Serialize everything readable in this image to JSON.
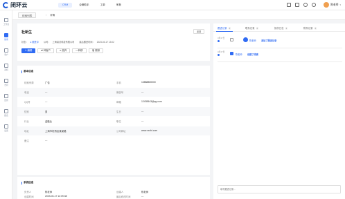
{
  "app": {
    "name": "闭环云"
  },
  "topnav": [
    "CRM",
    "企微助手",
    "工单",
    "审批"
  ],
  "user": {
    "name": "陈老师"
  },
  "sidebar": [
    {
      "label": "工作台"
    },
    {
      "label": "线索"
    },
    {
      "label": "客户"
    },
    {
      "label": "商机"
    },
    {
      "label": "合同"
    },
    {
      "label": "回款"
    },
    {
      "label": "报表"
    },
    {
      "label": "设置"
    }
  ],
  "tabs": {
    "list": "线索列表",
    "sep": "/",
    "detail": "详情"
  },
  "lead": {
    "name": "杜新生",
    "collapse": "返回",
    "meta": {
      "status_label": "状态：",
      "status": "● 跟进中",
      "company_label": "公司：",
      "company": "上海易试科技有限公司",
      "time_label": "最后跟进时间：",
      "time": "2023-03-17 13:02"
    },
    "actions": [
      "编辑",
      "转客户",
      "放弃",
      "转移",
      "删除"
    ]
  },
  "basic": {
    "title": "基本信息",
    "rows": [
      {
        "l1": "线索来源",
        "v1": "广告",
        "l2": "手机",
        "v2": "13888880000"
      },
      {
        "l1": "电话",
        "v1": "---",
        "l2": "微信号",
        "v2": "---"
      },
      {
        "l1": "QQ号",
        "v1": "---",
        "l2": "邮箱",
        "v2": "12435543@qq.com"
      },
      {
        "l1": "性别",
        "v1": "男",
        "l2": "生日",
        "v2": "---"
      },
      {
        "l1": "行业",
        "v1": "金融业",
        "l2": "职位",
        "v2": "---"
      },
      {
        "l1": "地址",
        "v1": "上海市虹桥区某某路",
        "l2": "公司网址",
        "v2": "www.xxxhi.com"
      },
      {
        "l1": "备注",
        "v1": "---",
        "l2": "",
        "v2": ""
      }
    ]
  },
  "system": {
    "title": "系统信息",
    "rows": [
      {
        "l1": "负责人",
        "v1": "陈老师",
        "l2": "创建人",
        "v2": "陈老师"
      },
      {
        "l1": "创建时间",
        "v1": "2023-03-17 12:09:38",
        "l2": "最后修改时间",
        "v2": "---"
      }
    ]
  },
  "right": {
    "tabs": [
      {
        "label": "跟进记录",
        "count": "0"
      },
      {
        "label": "联系记录",
        "count": "0"
      },
      {
        "label": "操作日志",
        "count": "2"
      },
      {
        "label": "附件记录",
        "count": "0"
      },
      {
        "label": "",
        "count": ""
      }
    ],
    "activities": [
      {
        "time": "3月17日",
        "who": "陈老师",
        "what": "添加了跟进记录"
      },
      {
        "time": "3月17日",
        "who": "陈老师",
        "what": "创建了线索"
      }
    ],
    "input_placeholder": "填写跟进记录..."
  },
  "colors": {
    "primary": "#2f6bf3"
  }
}
